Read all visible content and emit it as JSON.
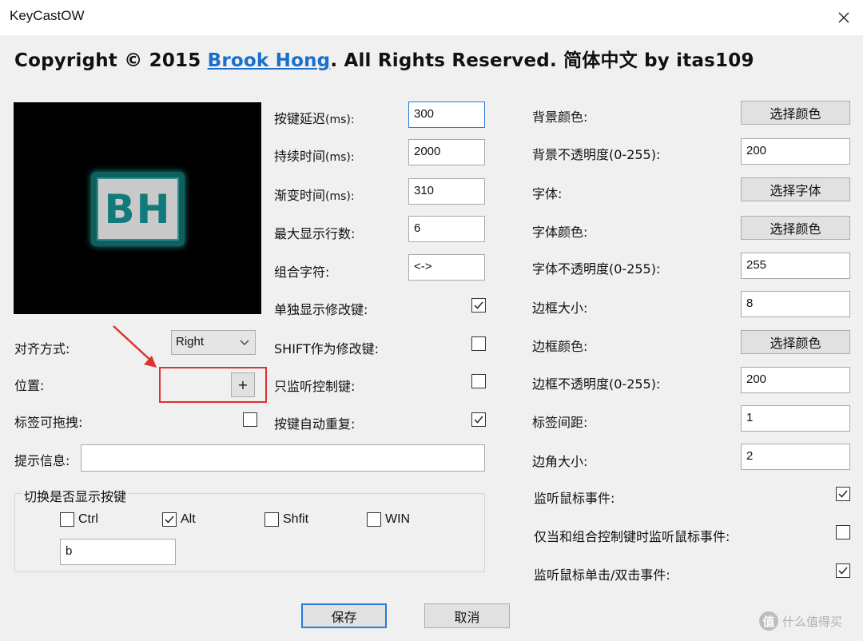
{
  "window": {
    "title": "KeyCastOW"
  },
  "header": {
    "prefix": "Copyright © 2015 ",
    "author_link": "Brook Hong",
    "suffix": ". All Rights Reserved. 简体中文 by itas109"
  },
  "preview": {
    "logo_text": "BH"
  },
  "left": {
    "align_label": "对齐方式:",
    "align_value": "Right",
    "position_label": "位置:",
    "position_button": "+",
    "draggable_label": "标签可拖拽:",
    "draggable_checked": false,
    "tip_label": "提示信息:",
    "tip_value": ""
  },
  "toggle_group": {
    "title": "切换是否显示按键",
    "ctrl_label": "Ctrl",
    "ctrl_checked": false,
    "alt_label": "Alt",
    "alt_checked": true,
    "shift_label": "Shfit",
    "shift_checked": false,
    "win_label": "WIN",
    "win_checked": false,
    "key_value": "b"
  },
  "middle": {
    "key_delay": {
      "label": "按键延迟",
      "unit": "(ms):",
      "value": "300"
    },
    "duration": {
      "label": "持续时间",
      "unit": "(ms):",
      "value": "2000"
    },
    "fade": {
      "label": "渐变时间",
      "unit": "(ms):",
      "value": "310"
    },
    "max_lines": {
      "label": "最大显示行数:",
      "value": "6"
    },
    "combo_char": {
      "label": "组合字符:",
      "value": "<->"
    },
    "show_modifier": {
      "label": "单独显示修改键:",
      "checked": true
    },
    "shift_modifier": {
      "label": "SHIFT作为修改键:",
      "checked": false
    },
    "only_control": {
      "label": "只监听控制键:",
      "checked": false
    },
    "auto_repeat": {
      "label": "按键自动重复:",
      "checked": true
    }
  },
  "right": {
    "bg_color": {
      "label": "背景颜色:",
      "button": "选择颜色"
    },
    "bg_opacity": {
      "label": "背景不透明度(0-255):",
      "value": "200"
    },
    "font": {
      "label": "字体:",
      "button": "选择字体"
    },
    "font_color": {
      "label": "字体颜色:",
      "button": "选择颜色"
    },
    "font_opacity": {
      "label": "字体不透明度(0-255):",
      "value": "255"
    },
    "border_size": {
      "label": "边框大小:",
      "value": "8"
    },
    "border_color": {
      "label": "边框颜色:",
      "button": "选择颜色"
    },
    "border_opacity": {
      "label": "边框不透明度(0-255):",
      "value": "200"
    },
    "label_spacing": {
      "label": "标签间距:",
      "value": "1"
    },
    "corner_size": {
      "label": "边角大小:",
      "value": "2"
    },
    "mouse_events": {
      "label": "监听鼠标事件:",
      "checked": true
    },
    "mouse_combo_only": {
      "label": "仅当和组合控制键时监听鼠标事件:",
      "checked": false
    },
    "mouse_click": {
      "label": "监听鼠标单击/双击事件:",
      "checked": true
    }
  },
  "footer": {
    "save": "保存",
    "cancel": "取消"
  },
  "watermark": {
    "icon": "值",
    "text": "什么值得买"
  },
  "colors": {
    "accent": "#2a7ad6",
    "link": "#1a6fcc",
    "logo_teal": "#127a7a",
    "annotation_red": "#e03030"
  }
}
